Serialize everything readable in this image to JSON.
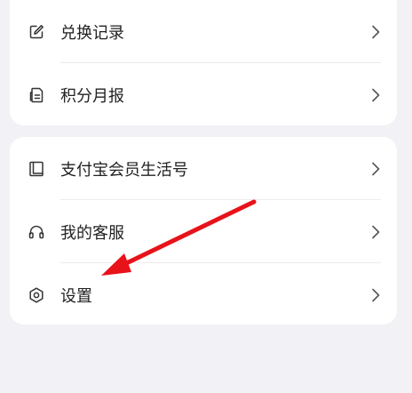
{
  "menu": {
    "group1": [
      {
        "label": "兑换记录",
        "icon": "edit-note-icon"
      },
      {
        "label": "积分月报",
        "icon": "report-document-icon"
      }
    ],
    "group2": [
      {
        "label": "支付宝会员生活号",
        "icon": "bookmark-book-icon"
      },
      {
        "label": "我的客服",
        "icon": "headset-icon"
      },
      {
        "label": "设置",
        "icon": "settings-hexagon-icon"
      }
    ]
  },
  "colors": {
    "background": "#f2f2f6",
    "card": "#ffffff",
    "text": "#222222",
    "chevron": "#555555",
    "annotation_arrow": "#e8121a"
  }
}
